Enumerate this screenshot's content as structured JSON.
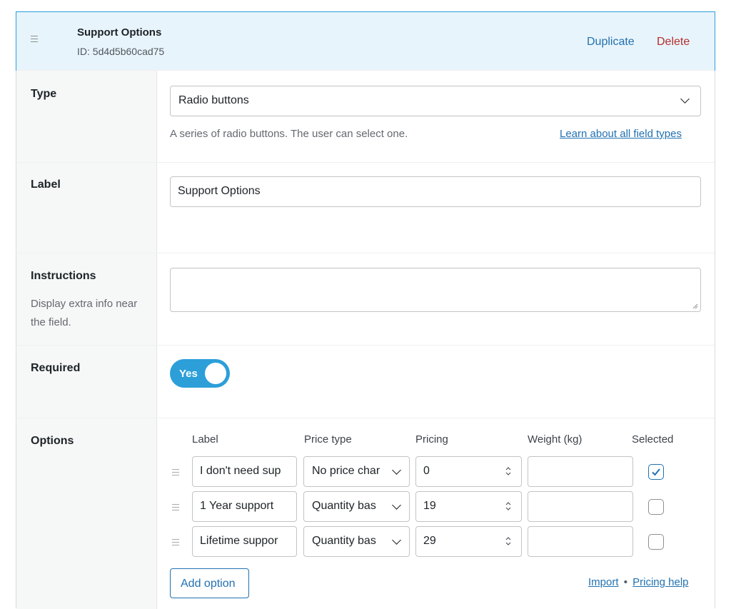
{
  "header": {
    "title": "Support Options",
    "id_text": "ID: 5d4d5b60cad75",
    "duplicate_label": "Duplicate",
    "delete_label": "Delete"
  },
  "type_row": {
    "label": "Type",
    "selected": "Radio buttons",
    "help": "A series of radio buttons. The user can select one.",
    "link": "Learn about all field types"
  },
  "label_row": {
    "label": "Label",
    "value": "Support Options"
  },
  "instructions_row": {
    "label": "Instructions",
    "sub": "Display extra info near the field.",
    "value": ""
  },
  "required_row": {
    "label": "Required",
    "toggle_text": "Yes",
    "on": true
  },
  "options_row": {
    "label": "Options",
    "columns": {
      "label": "Label",
      "price_type": "Price type",
      "pricing": "Pricing",
      "weight": "Weight (kg)",
      "selected": "Selected"
    },
    "items": [
      {
        "label": "I don't need sup",
        "price_type": "No price char",
        "pricing": "0",
        "weight": "",
        "selected": true
      },
      {
        "label": "1 Year support",
        "price_type": "Quantity bas",
        "pricing": "19",
        "weight": "",
        "selected": false
      },
      {
        "label": "Lifetime suppor",
        "price_type": "Quantity bas",
        "pricing": "29",
        "weight": "",
        "selected": false
      }
    ],
    "add_button": "Add option",
    "import_link": "Import",
    "separator": "•",
    "pricing_help_link": "Pricing help"
  },
  "colors": {
    "accent": "#2271b1",
    "toggle": "#2c9fd9",
    "delete": "#b32d2e",
    "header_bg": "#e8f4fb"
  }
}
